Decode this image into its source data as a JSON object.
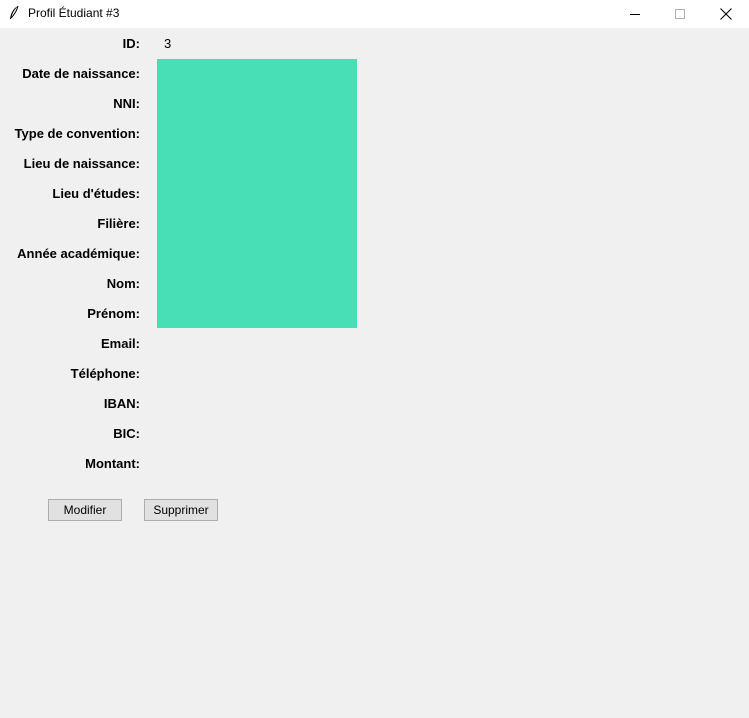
{
  "window": {
    "title": "Profil Étudiant #3",
    "controls": [
      "minimize-icon",
      "maximize-icon",
      "close-icon"
    ]
  },
  "fields": [
    {
      "label": "ID:",
      "value": "3"
    },
    {
      "label": "Date de naissance:",
      "value": ""
    },
    {
      "label": "NNI:",
      "value": ""
    },
    {
      "label": "Type de convention:",
      "value": ""
    },
    {
      "label": "Lieu de naissance:",
      "value": ""
    },
    {
      "label": "Lieu d'études:",
      "value": ""
    },
    {
      "label": "Filière:",
      "value": ""
    },
    {
      "label": "Année académique:",
      "value": ""
    },
    {
      "label": "Nom:",
      "value": ""
    },
    {
      "label": "Prénom:",
      "value": ""
    },
    {
      "label": "Email:",
      "value": ""
    },
    {
      "label": "Téléphone:",
      "value": ""
    },
    {
      "label": "IBAN:",
      "value": ""
    },
    {
      "label": "BIC:",
      "value": ""
    },
    {
      "label": "Montant:",
      "value": ""
    }
  ],
  "photo": {
    "color": "#48dfb6"
  },
  "buttons": {
    "modify": "Modifier",
    "delete": "Supprimer"
  }
}
